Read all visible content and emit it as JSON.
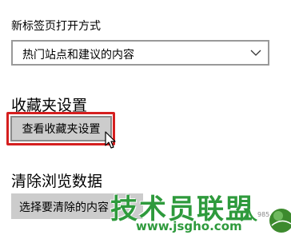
{
  "newtab": {
    "label": "新标签页打开方式",
    "dropdown_value": "热门站点和建议的内容"
  },
  "favorites": {
    "heading": "收藏夹设置",
    "button_label": "查看收藏夹设置"
  },
  "clear_data": {
    "heading": "清除浏览数据",
    "button_label": "选择要清除的内容"
  },
  "watermark": {
    "title": "技术员联盟",
    "url": "www.jsgho.com",
    "person": "人",
    "small": "985.com"
  },
  "colors": {
    "highlight_border": "#d51f1f",
    "watermark_green": "#2e9a3c",
    "button_bg": "#cccccc"
  },
  "icons": {
    "dropdown": "chevron-down-icon",
    "cursor": "mouse-pointer-icon",
    "globe": "globe-icon"
  }
}
